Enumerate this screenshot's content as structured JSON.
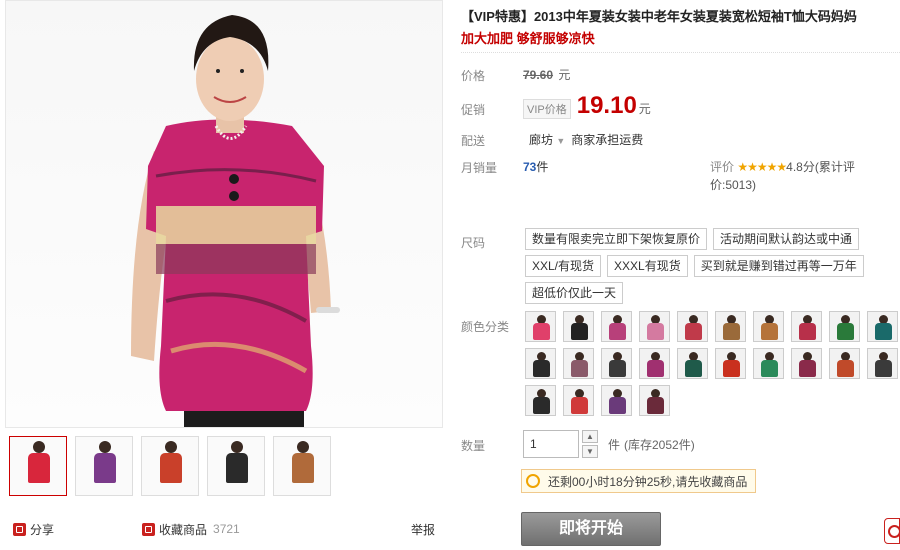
{
  "title": "【VIP特惠】2013中年夏装女装中老年女装夏装宽松短袖T恤大码妈妈",
  "subtitle": "加大加肥 够舒服够凉快",
  "labels": {
    "price": "价格",
    "promo": "促销",
    "ship": "配送",
    "sales": "月销量",
    "review": "评价",
    "size": "尺码",
    "color": "颜色分类",
    "qty": "数量"
  },
  "price": {
    "original": "79.60",
    "currency": "元"
  },
  "promo": {
    "tag": "VIP价格",
    "price": "19.10",
    "currency": "元"
  },
  "ship": {
    "location": "廊坊",
    "note": "商家承担运费"
  },
  "sales": {
    "count": "73",
    "unit": "件"
  },
  "review": {
    "stars": "★★★★★",
    "score": "4.8分",
    "count": "(累计评价:5013)"
  },
  "sizes": [
    "数量有限卖完立即下架恢复原价",
    "活动期间默认韵达或中通",
    "XXL/有现货",
    "XXXL有现货",
    "买到就是赚到错过再等一万年",
    "超低价仅此一天"
  ],
  "swatch_colors": [
    "#e0406a",
    "#222222",
    "#b8407a",
    "#d47aa0",
    "#c03a4a",
    "#9a6a3a",
    "#b5733a",
    "#b8304a",
    "#2a7a3a",
    "#1a6a6a",
    "#2a2a2a",
    "#8a5a6a",
    "#3a3a3a",
    "#a03070",
    "#1f5a4a",
    "#c9301e",
    "#2a8a5a",
    "#8a2a4a",
    "#c04a2a",
    "#3a3a3a",
    "#2a2a2a",
    "#d03a3a",
    "#6a3a7a",
    "#6a2a3a"
  ],
  "quantity": {
    "value": "1",
    "unit": "件",
    "stock": "(库存2052件)"
  },
  "notice": "还剩00小时18分钟25秒,请先收藏商品",
  "start_button": "即将开始",
  "footer": {
    "share": "分享",
    "favorite": "收藏商品",
    "fav_count": "3721",
    "report": "举报"
  },
  "thumb_colors": [
    "#d8263c",
    "#7a3a8a",
    "#c9402a",
    "#2a2a2a",
    "#b06a3a"
  ]
}
